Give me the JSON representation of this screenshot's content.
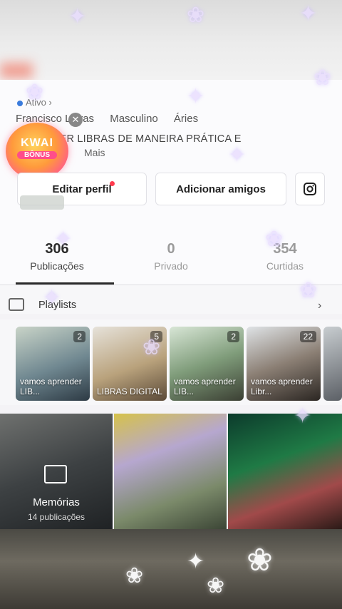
{
  "profile": {
    "status_text": "Ativo",
    "tags": [
      "Francisco Libras",
      "Masculino",
      "Áries"
    ],
    "bio": "APRENDER LIBRAS DE MANEIRA PRÁTICA E",
    "more_label": "Mais",
    "badge_title": "KWAI",
    "badge_sub": "BÔNUS",
    "close_glyph": "✕"
  },
  "actions": {
    "edit_label": "Editar perfil",
    "add_label": "Adicionar amigos",
    "instagram_icon": "instagram-icon"
  },
  "stats": [
    {
      "value": "306",
      "label": "Publicações"
    },
    {
      "value": "0",
      "label": "Privado"
    },
    {
      "value": "354",
      "label": "Curtidas"
    }
  ],
  "playlists": {
    "title": "Playlists",
    "items": [
      {
        "count": "2",
        "caption": "vamos aprender LIB..."
      },
      {
        "count": "5",
        "caption": "LIBRAS DIGITAL"
      },
      {
        "count": "2",
        "caption": "vamos aprender LIB..."
      },
      {
        "count": "22",
        "caption": "vamos aprender Libr..."
      }
    ]
  },
  "memories": {
    "label": "Memórias",
    "sub": "14 publicações"
  },
  "colors": {
    "accent": "#ff3b4e",
    "text": "#2a2a2a",
    "butterfly": "#e9ddff"
  }
}
